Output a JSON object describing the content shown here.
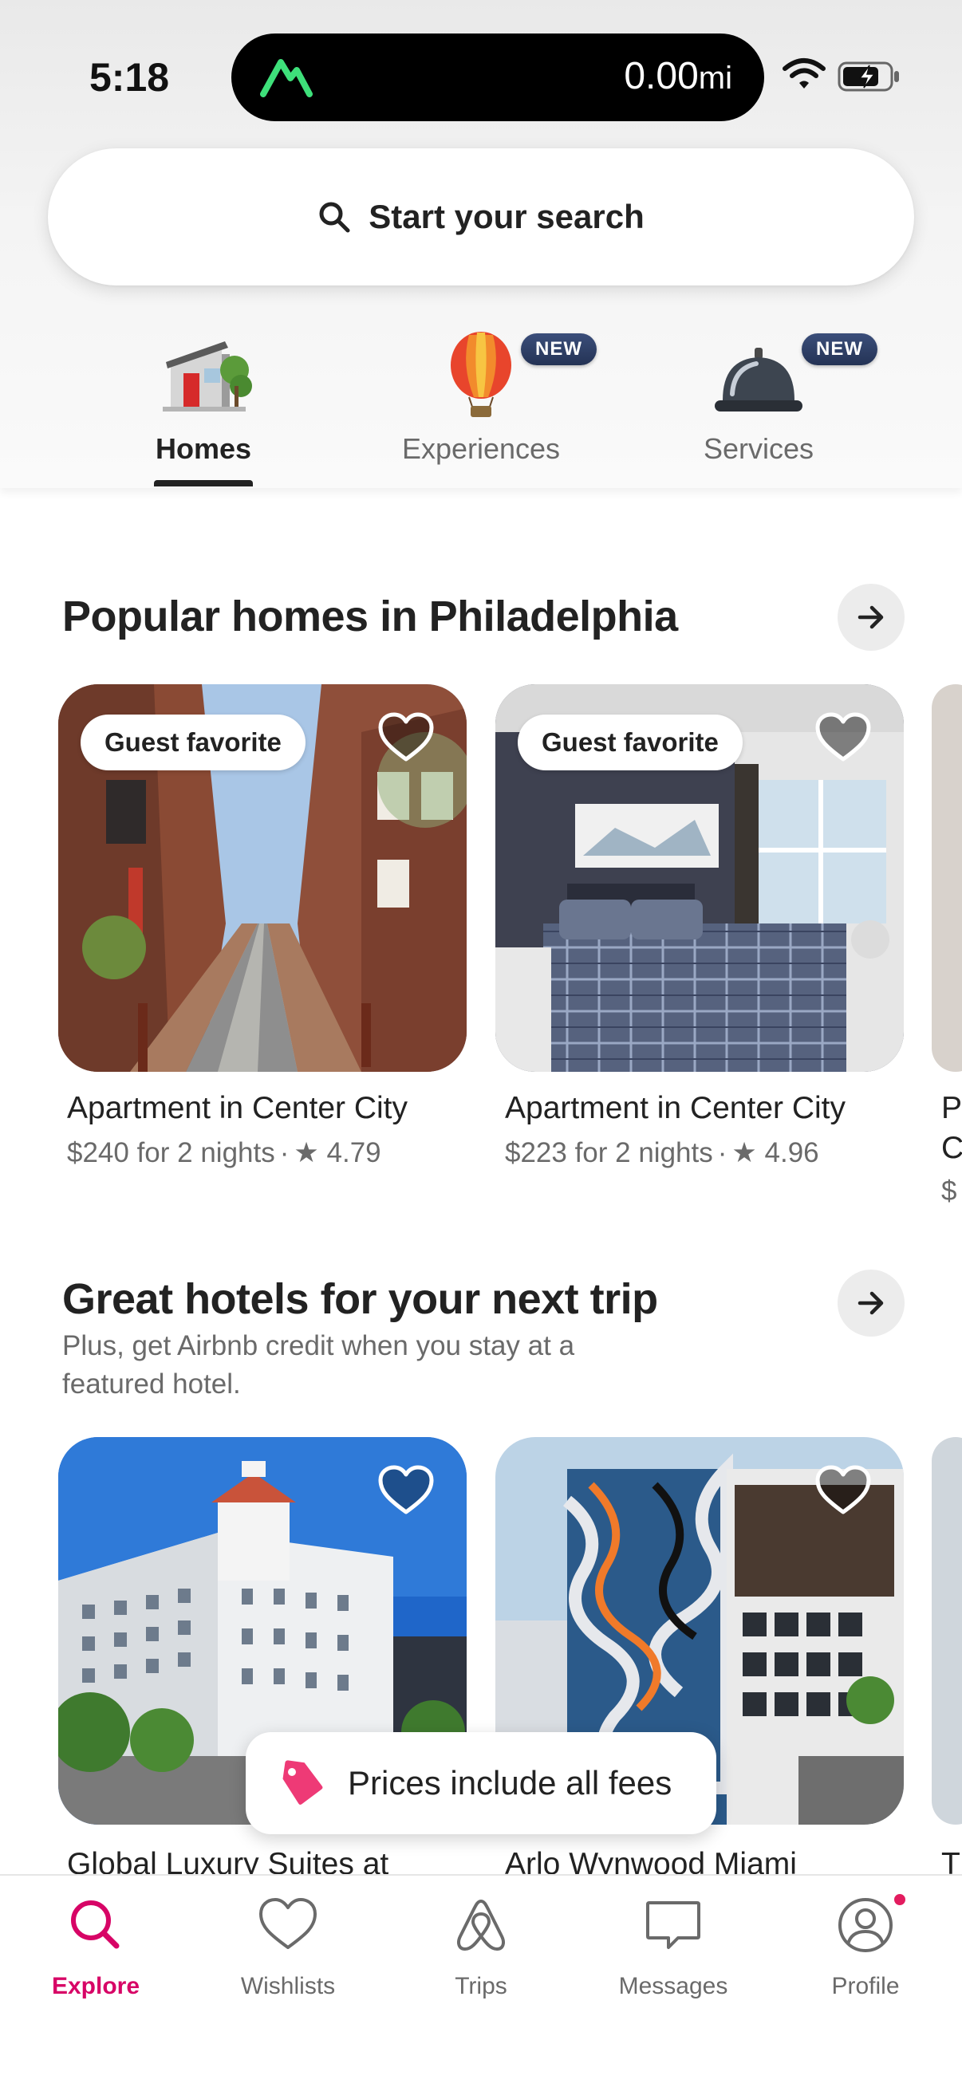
{
  "status_bar": {
    "time": "5:18",
    "distance_value": "0.00",
    "distance_unit": "mi"
  },
  "search": {
    "label": "Start your search"
  },
  "categories": [
    {
      "label": "Homes",
      "active": true,
      "badge": ""
    },
    {
      "label": "Experiences",
      "active": false,
      "badge": "NEW"
    },
    {
      "label": "Services",
      "active": false,
      "badge": "NEW"
    }
  ],
  "section_popular": {
    "title": "Popular homes in Philadelphia",
    "cards": [
      {
        "badge": "Guest favorite",
        "title": "Apartment in Center City",
        "price": "$240 for 2 nights",
        "rating": "★ 4.79"
      },
      {
        "badge": "Guest favorite",
        "title": "Apartment in Center City",
        "price": "$223 for 2 nights",
        "rating": "★ 4.96"
      },
      {
        "title_partial": "P",
        "title_partial2": "C",
        "price_partial": "$"
      }
    ]
  },
  "section_hotels": {
    "title": "Great hotels for your next trip",
    "subtitle": "Plus, get Airbnb credit when you stay at a featured hotel.",
    "cards": [
      {
        "title": "Global Luxury Suites at"
      },
      {
        "title": "Arlo Wynwood Miami"
      },
      {
        "title_partial": "T"
      }
    ]
  },
  "toast": {
    "label": "Prices include all fees"
  },
  "bottom_nav": [
    {
      "label": "Explore",
      "icon": "search-icon",
      "active": true
    },
    {
      "label": "Wishlists",
      "icon": "heart-icon",
      "active": false
    },
    {
      "label": "Trips",
      "icon": "airbnb-logo-icon",
      "active": false
    },
    {
      "label": "Messages",
      "icon": "message-icon",
      "active": false
    },
    {
      "label": "Profile",
      "icon": "profile-icon",
      "active": false
    }
  ],
  "colors": {
    "accent": "#d70466",
    "text": "#222222",
    "muted": "#6a6a6a"
  }
}
